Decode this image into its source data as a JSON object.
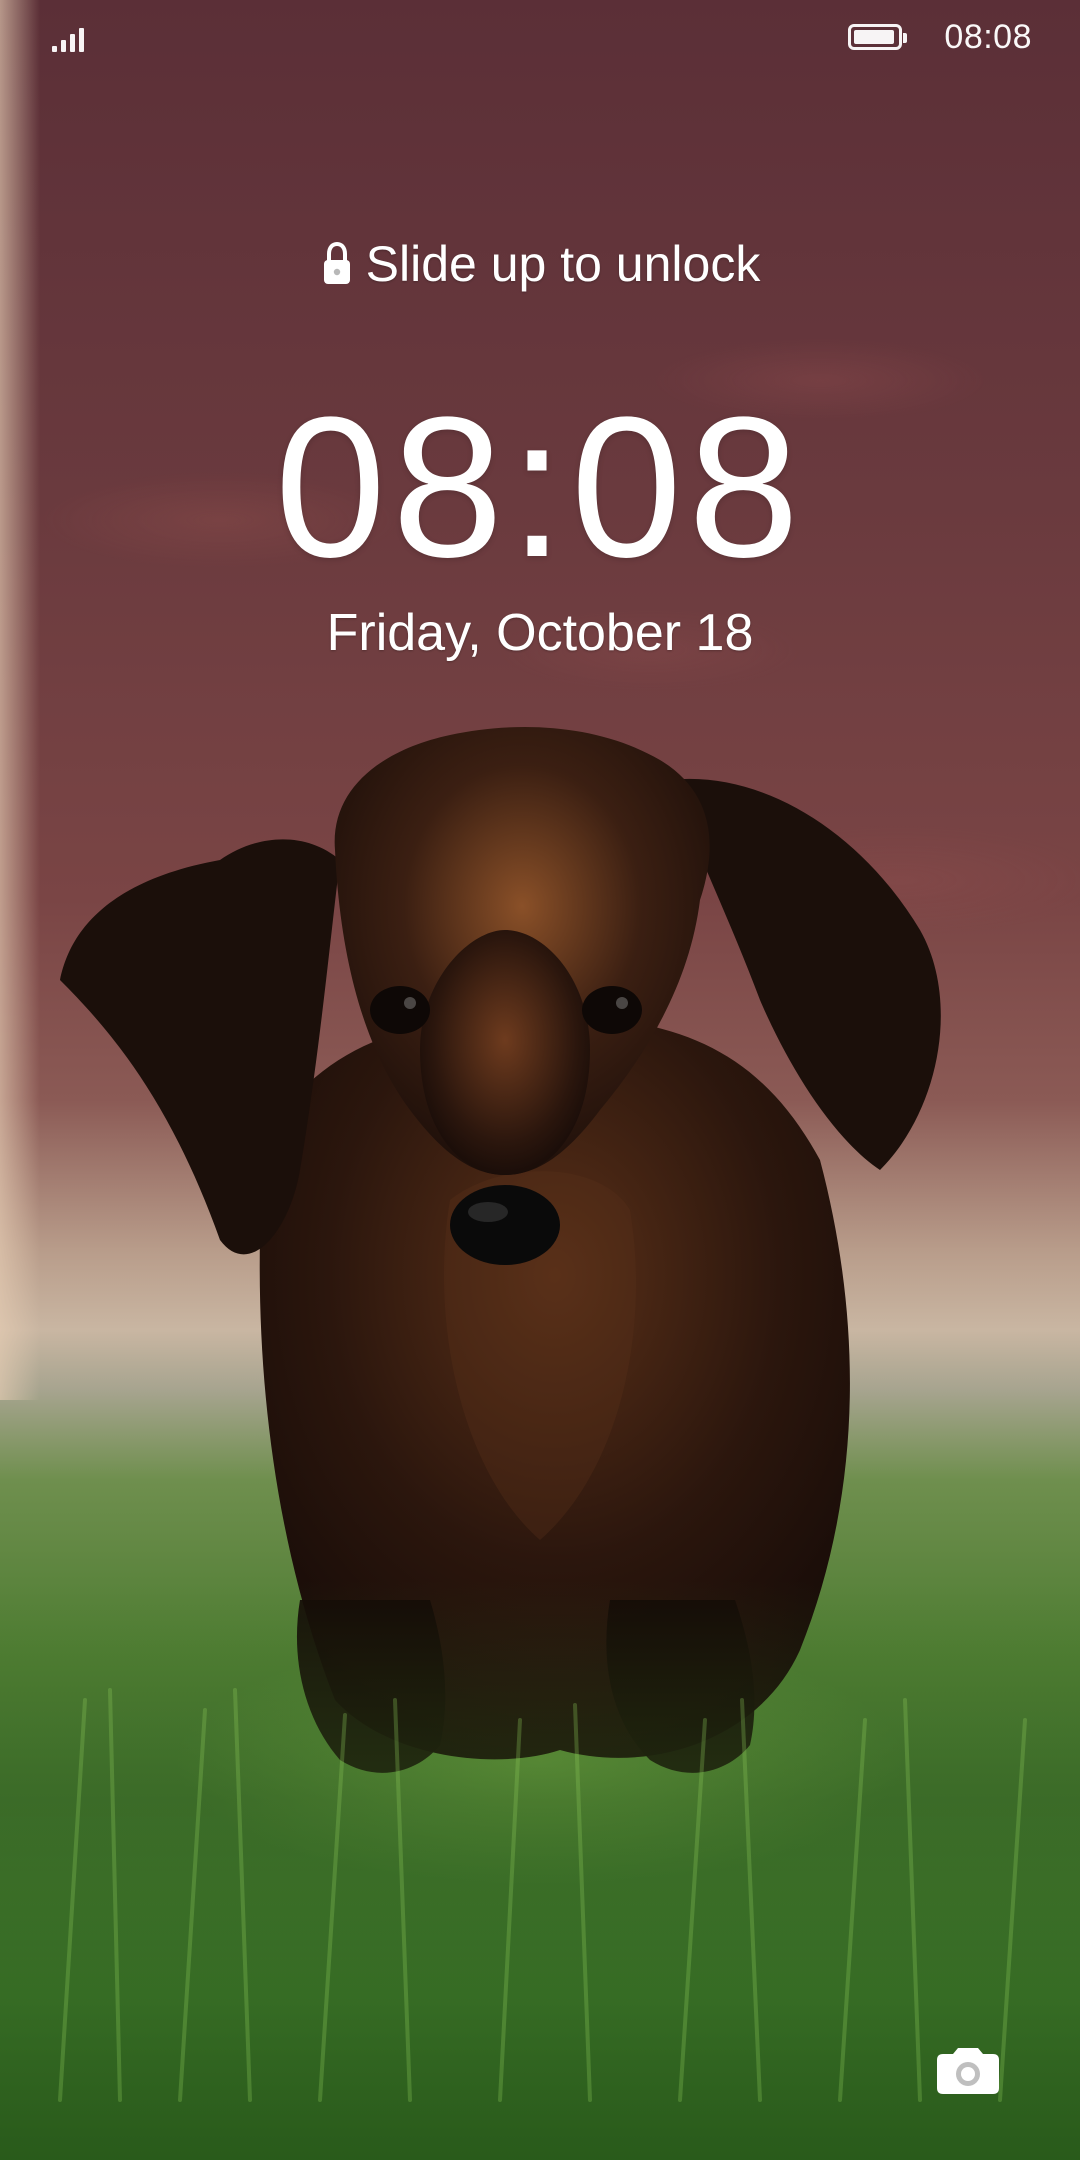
{
  "status_bar": {
    "time": "08:08",
    "signal_icon": "cellular-signal-icon",
    "battery_icon": "battery-icon",
    "battery_level": 0.95
  },
  "lock_screen": {
    "hint_icon": "lock-icon",
    "hint": "Slide up to unlock",
    "clock": "08:08",
    "date": "Friday, October 18"
  },
  "shortcuts": {
    "camera_icon": "camera-icon"
  }
}
